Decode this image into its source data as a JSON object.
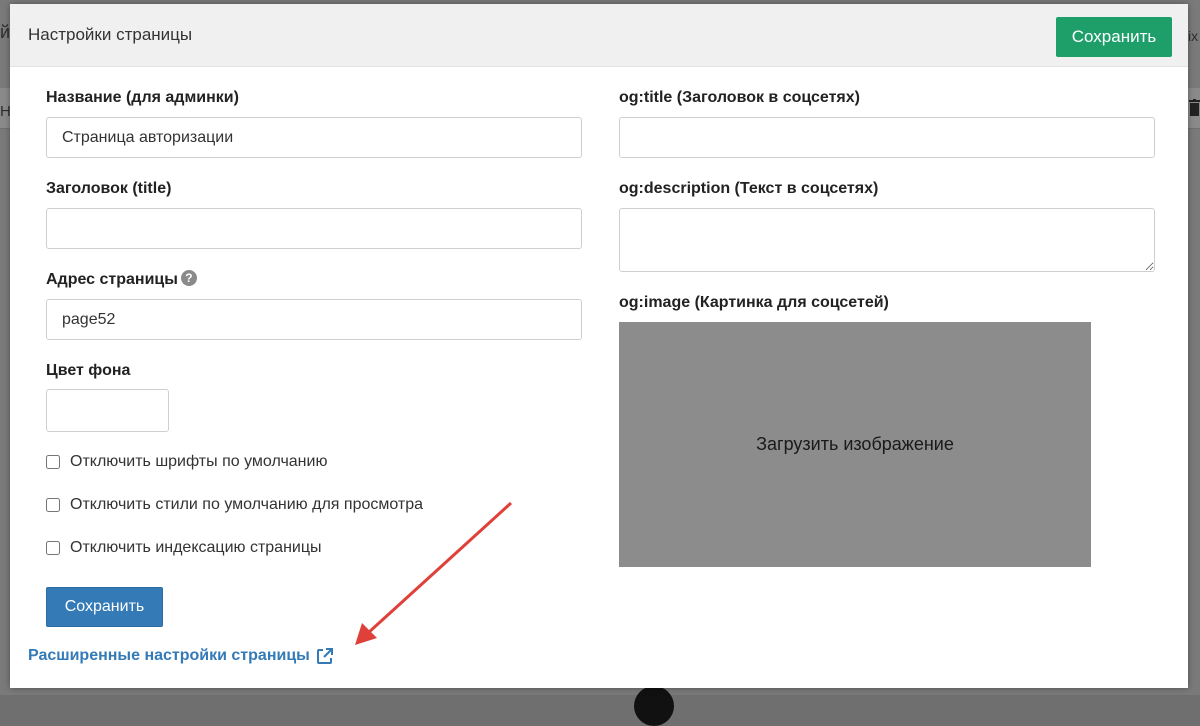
{
  "background": {
    "left_text": "й",
    "left_text2": "Н",
    "right_text": "ix"
  },
  "modal": {
    "title": "Настройки страницы",
    "header_save": "Сохранить"
  },
  "form": {
    "name_label": "Название (для админки)",
    "name_value": "Страница авторизации",
    "title_label": "Заголовок (title)",
    "title_value": "",
    "address_label": "Адрес страницы",
    "address_help": "?",
    "address_value": "page52",
    "bgcolor_label": "Цвет фона",
    "bgcolor_value": "",
    "checkboxes": [
      {
        "label": "Отключить шрифты по умолчанию",
        "checked": false
      },
      {
        "label": "Отключить стили по умолчанию для просмотра",
        "checked": false
      },
      {
        "label": "Отключить индексацию страницы",
        "checked": false
      }
    ],
    "save": "Сохранить"
  },
  "social": {
    "og_title_label": "og:title (Заголовок в соцсетях)",
    "og_title_value": "",
    "og_description_label": "og:description (Текст в соцсетях)",
    "og_description_value": "",
    "og_image_label": "og:image (Картинка для соцсетей)",
    "upload_text": "Загрузить изображение"
  },
  "advanced_link": "Расширенные настройки страницы",
  "icons": {
    "help": "question-circle-icon",
    "external": "external-link-icon",
    "trash": "trash-icon"
  },
  "colors": {
    "header_save_bg": "#1e9f6a",
    "save_bg": "#337ab7",
    "link": "#337ab7",
    "upload_bg": "#8c8c8c",
    "annotation_arrow": "#e0403a"
  }
}
